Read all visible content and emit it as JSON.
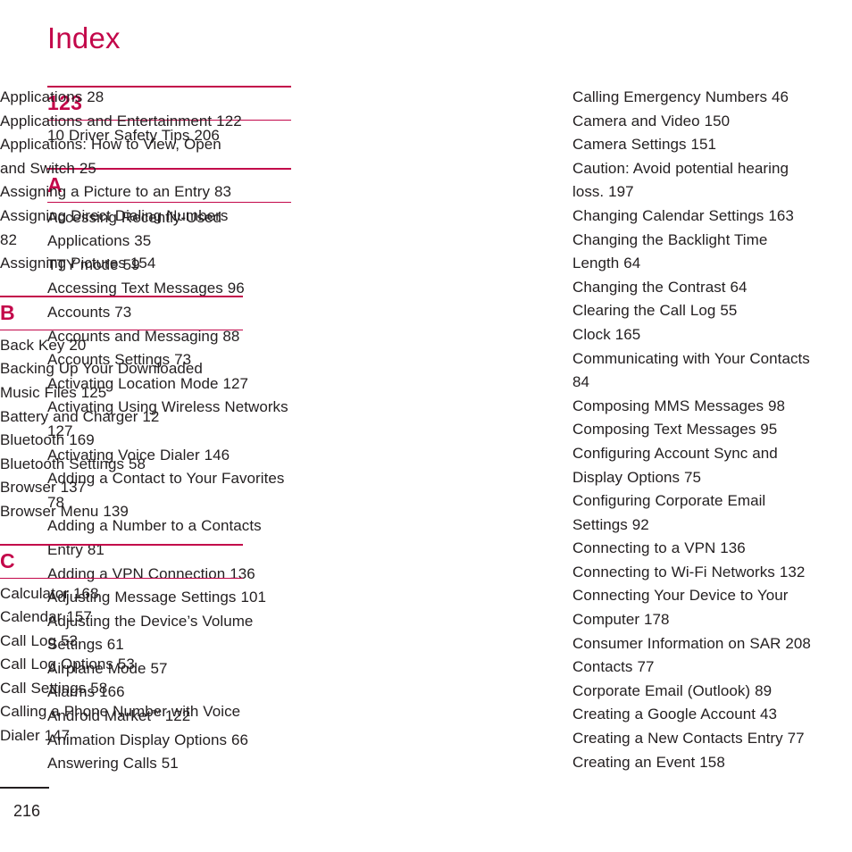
{
  "document": {
    "title": "Index",
    "folio": "216",
    "accent_color": "#c3074a",
    "text_color": "#231f20"
  },
  "columns": [
    {
      "name": "column-1",
      "blocks": [
        {
          "type": "section",
          "letter": "123",
          "entries": [
            "10 Driver Safety Tips 206"
          ]
        },
        {
          "type": "section",
          "letter": "A",
          "entries": [
            "Accessing Recently-Used Applications 35",
            "TTY mode 59",
            "Accessing Text Messages 96",
            "Accounts 73",
            "Accounts and Messaging 88",
            "Accounts Settings 73",
            "Activating Location Mode 127",
            "Activating Using Wireless Networks 127",
            "Activating Voice Dialer 146",
            "Adding a Contact to Your Favorites 78",
            "Adding a Number to a Contacts Entry 81",
            "Adding a VPN Connection 136",
            "Adjusting Message Settings 101",
            "Adjusting the Device’s Volume Settings 61",
            "Airplane Mode 57",
            "Alarms 166",
            "Android Market™ 122",
            "Animation Display Options 66",
            "Answering Calls 51"
          ]
        }
      ]
    },
    {
      "name": "column-2",
      "blocks": [
        {
          "type": "entries",
          "entries": [
            "Applications 28",
            "Applications and Entertainment 122",
            "Applications: How to View, Open and Switch 25",
            "Assigning a Picture to an Entry 83",
            "Assigning Direct Dialing Numbers 82",
            "Assigning Pictures 154"
          ]
        },
        {
          "type": "section",
          "letter": "B",
          "entries": [
            "Back Key 20",
            "Backing Up Your Downloaded Music Files 125",
            "Battery and Charger 12",
            "Bluetooth 169",
            "Bluetooth Settings 58",
            "Browser 137",
            "Browser Menu 139"
          ]
        },
        {
          "type": "section",
          "letter": "C",
          "entries": [
            "Calculator 168",
            "Calendar 157",
            "Call Log 53",
            "Call Log Options 53",
            "Call Settings 58",
            "Calling a Phone Number with Voice Dialer 147"
          ]
        }
      ]
    },
    {
      "name": "column-3",
      "blocks": [
        {
          "type": "entries",
          "entries": [
            "Calling Emergency Numbers 46",
            "Camera and Video 150",
            "Camera Settings 151",
            "Caution: Avoid potential hearing loss. 197",
            "Changing Calendar Settings 163",
            "Changing the Backlight Time Length 64",
            "Changing the Contrast 64",
            "Clearing the Call Log 55",
            "Clock 165",
            "Communicating with Your Contacts 84",
            "Composing MMS Messages 98",
            "Composing Text Messages 95",
            "Configuring Account Sync and Display Options 75",
            "Configuring Corporate Email Settings 92",
            "Connecting to a VPN 136",
            "Connecting to Wi-Fi Networks 132",
            "Connecting Your Device to Your Computer 178",
            "Consumer Information on SAR 208",
            "Contacts 77",
            "Corporate Email (Outlook) 89",
            "Creating a Google Account 43",
            "Creating a New Contacts Entry 77",
            "Creating an Event 158"
          ]
        }
      ]
    }
  ]
}
